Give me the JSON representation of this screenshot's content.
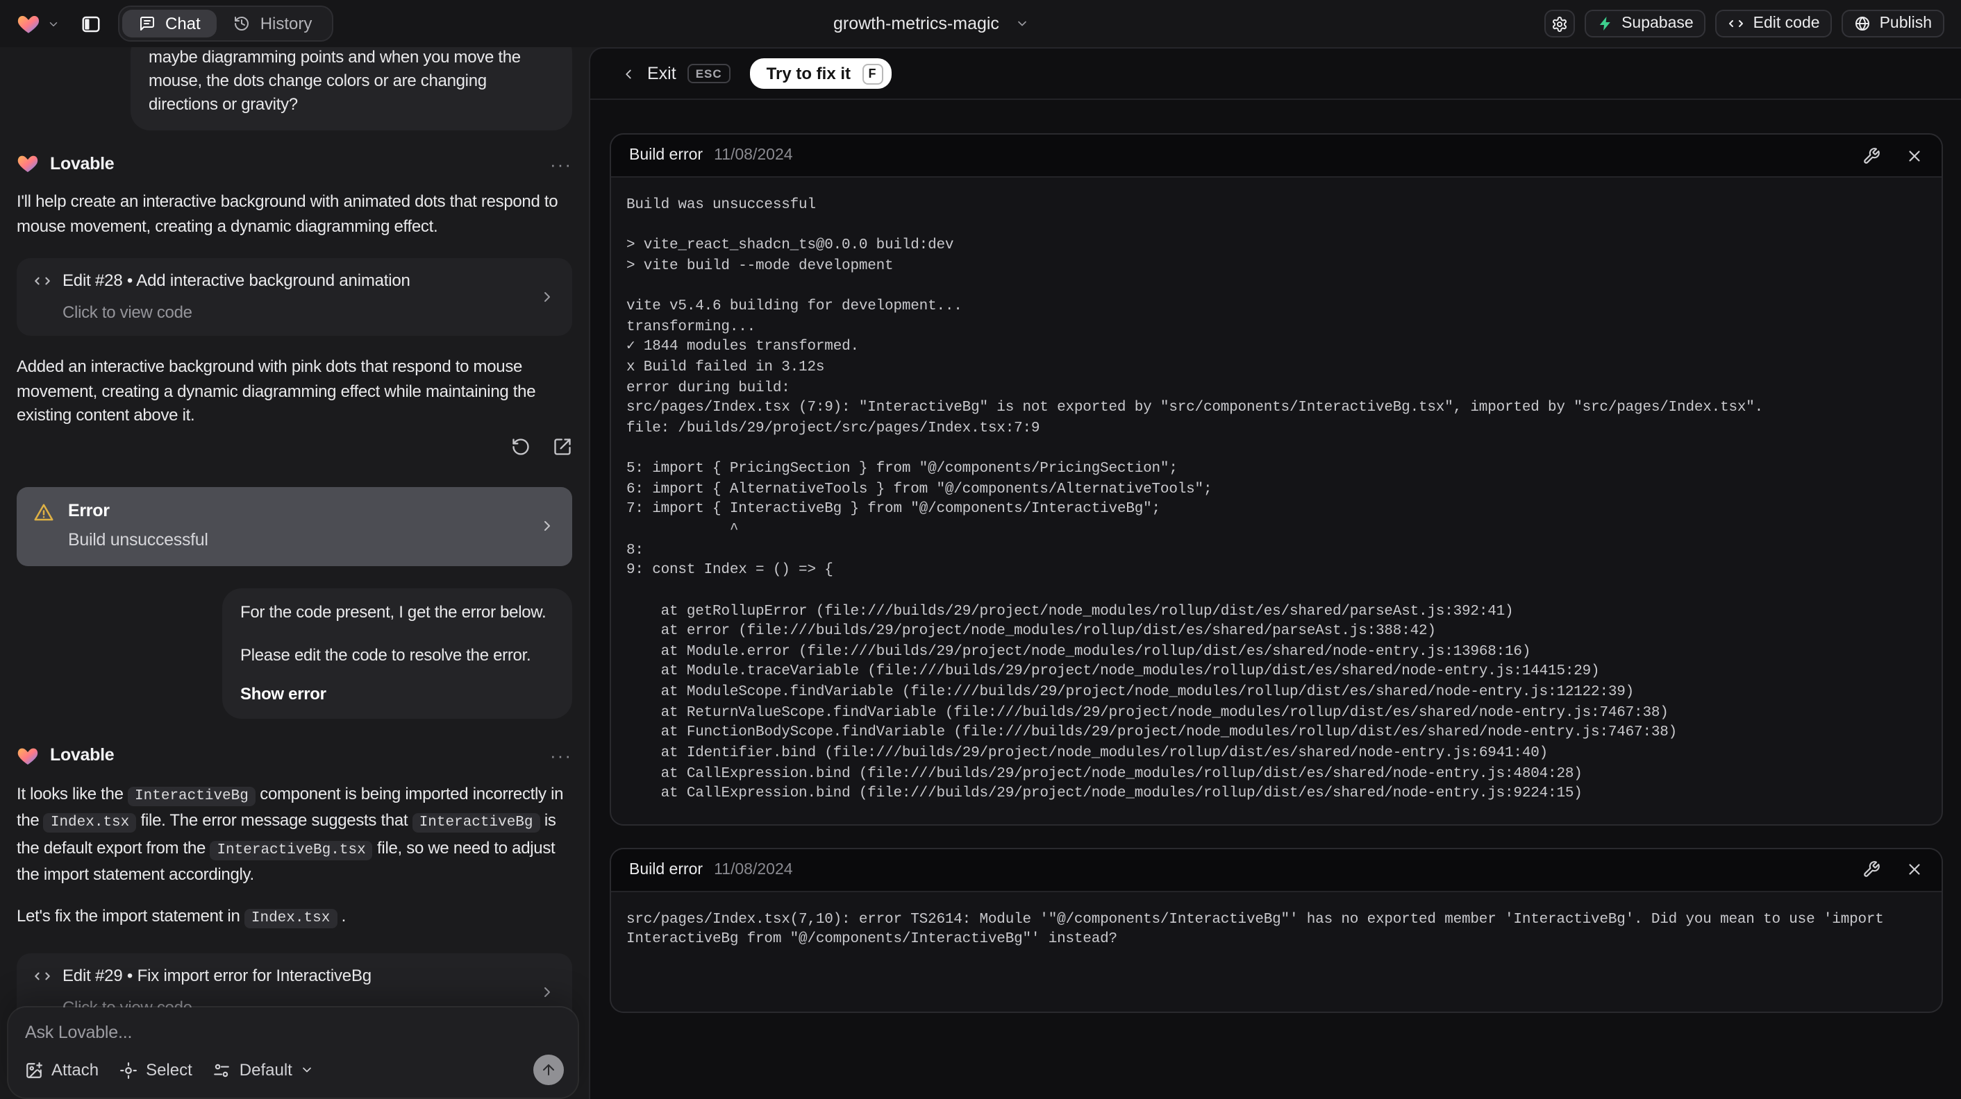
{
  "colors": {
    "warning_amber": "#deb145",
    "supabase_green": "#3ecf8e",
    "chat_panel_bg": "#1b1b1d",
    "preview_bg": "#0f0f11",
    "error_card_bg": "#4c4d53"
  },
  "topbar": {
    "tabs": {
      "chat": "Chat",
      "history": "History"
    },
    "project_name": "growth-metrics-magic",
    "actions": {
      "supabase": "Supabase",
      "edit_code": "Edit code",
      "publish": "Publish"
    }
  },
  "chat": {
    "user1": {
      "text": "maybe diagramming points and when you move the mouse, the dots change colors or are changing directions or gravity?"
    },
    "a1": {
      "name": "Lovable",
      "more": "···",
      "intro": "I'll help create an interactive background with animated dots that respond to mouse movement, creating a dynamic diagramming effect.",
      "edit": {
        "title": "Edit #28 • Add interactive background animation",
        "subtitle": "Click to view code"
      },
      "summary": "Added an interactive background with pink dots that respond to mouse movement, creating a dynamic diagramming effect while maintaining the existing content above it."
    },
    "error_card": {
      "title": "Error",
      "subtitle": "Build unsuccessful"
    },
    "user2": {
      "p1": "For the code present, I get the error below.",
      "p2": "Please edit the code to resolve the error.",
      "action": "Show error"
    },
    "a2": {
      "name": "Lovable",
      "more": "···",
      "p1": [
        {
          "type": "text",
          "value": "It looks like the "
        },
        {
          "type": "code",
          "value": "InteractiveBg"
        },
        {
          "type": "text",
          "value": " component is being imported incorrectly in the "
        },
        {
          "type": "code",
          "value": "Index.tsx"
        },
        {
          "type": "text",
          "value": " file. The error message suggests that "
        },
        {
          "type": "code",
          "value": "InteractiveBg"
        },
        {
          "type": "text",
          "value": " is the default export from the "
        },
        {
          "type": "code",
          "value": "InteractiveBg.tsx"
        },
        {
          "type": "text",
          "value": " file, so we need to adjust the import statement accordingly."
        }
      ],
      "p2": [
        {
          "type": "text",
          "value": "Let's fix the import statement in "
        },
        {
          "type": "code",
          "value": "Index.tsx"
        },
        {
          "type": "text",
          "value": " ."
        }
      ],
      "edit": {
        "title": "Edit #29 • Fix import error for InteractiveBg",
        "subtitle": "Click to view code"
      }
    },
    "composer": {
      "placeholder": "Ask Lovable...",
      "attach": "Attach",
      "select": "Select",
      "mode": "Default"
    }
  },
  "preview": {
    "toolbar": {
      "exit": "Exit",
      "esc_key": "ESC",
      "fix": "Try to fix it",
      "fix_key": "F"
    },
    "cards": [
      {
        "title": "Build error",
        "date": "11/08/2024",
        "log": [
          "Build was unsuccessful",
          "",
          "> vite_react_shadcn_ts@0.0.0 build:dev",
          "> vite build --mode development",
          "",
          "vite v5.4.6 building for development...",
          "transforming...",
          "✓ 1844 modules transformed.",
          "x Build failed in 3.12s",
          "error during build:",
          "src/pages/Index.tsx (7:9): \"InteractiveBg\" is not exported by \"src/components/InteractiveBg.tsx\", imported by \"src/pages/Index.tsx\".",
          "file: /builds/29/project/src/pages/Index.tsx:7:9",
          "",
          "5: import { PricingSection } from \"@/components/PricingSection\";",
          "6: import { AlternativeTools } from \"@/components/AlternativeTools\";",
          "7: import { InteractiveBg } from \"@/components/InteractiveBg\";",
          "            ^",
          "8: ",
          "9: const Index = () => {",
          "",
          "    at getRollupError (file:///builds/29/project/node_modules/rollup/dist/es/shared/parseAst.js:392:41)",
          "    at error (file:///builds/29/project/node_modules/rollup/dist/es/shared/parseAst.js:388:42)",
          "    at Module.error (file:///builds/29/project/node_modules/rollup/dist/es/shared/node-entry.js:13968:16)",
          "    at Module.traceVariable (file:///builds/29/project/node_modules/rollup/dist/es/shared/node-entry.js:14415:29)",
          "    at ModuleScope.findVariable (file:///builds/29/project/node_modules/rollup/dist/es/shared/node-entry.js:12122:39)",
          "    at ReturnValueScope.findVariable (file:///builds/29/project/node_modules/rollup/dist/es/shared/node-entry.js:7467:38)",
          "    at FunctionBodyScope.findVariable (file:///builds/29/project/node_modules/rollup/dist/es/shared/node-entry.js:7467:38)",
          "    at Identifier.bind (file:///builds/29/project/node_modules/rollup/dist/es/shared/node-entry.js:6941:40)",
          "    at CallExpression.bind (file:///builds/29/project/node_modules/rollup/dist/es/shared/node-entry.js:4804:28)",
          "    at CallExpression.bind (file:///builds/29/project/node_modules/rollup/dist/es/shared/node-entry.js:9224:15)"
        ]
      },
      {
        "title": "Build error",
        "date": "11/08/2024",
        "log": [
          "src/pages/Index.tsx(7,10): error TS2614: Module '\"@/components/InteractiveBg\"' has no exported member 'InteractiveBg'. Did you mean to use 'import InteractiveBg from \"@/components/InteractiveBg\"' instead?"
        ]
      }
    ]
  }
}
